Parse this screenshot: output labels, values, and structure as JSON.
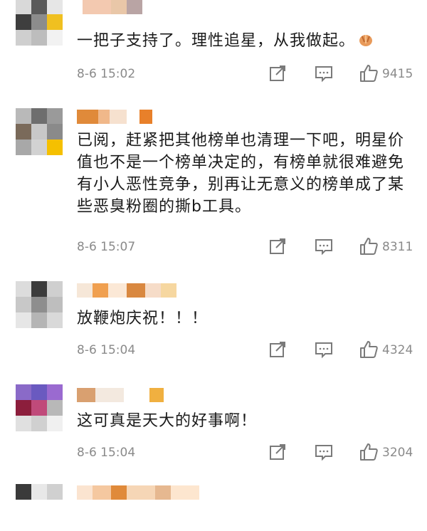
{
  "comments": [
    {
      "text": "一把子支持了。理性追星，从我做起。",
      "reaction_icon": "praying-hands-emoji",
      "time": "8-6 15:02",
      "likes": "9415",
      "avatar_colors": [
        "#d9d9d9",
        "#5a5a5a",
        "#e6e6e6",
        "#3e3e3e",
        "#8c8c8c",
        "#f0c020",
        "#cfcfcf",
        "#bdbdbd",
        "#f2f2f2"
      ],
      "name_colors": [
        "#ffffff",
        "#f3c9b0",
        "#e9c7a8",
        "#b9a4a4"
      ]
    },
    {
      "text": "已阅，赶紧把其他榜单也清理一下吧，明星价值也不是一个榜单决定的，有榜单就很难避免有小人恶性竞争，别再让无意义的榜单成了某些恶臭粉圈的撕b工具。",
      "time": "8-6 15:07",
      "likes": "8311",
      "avatar_colors": [
        "#b9b9b9",
        "#6e6e6e",
        "#9a9a9a",
        "#7a6a5a",
        "#c8c8c8",
        "#8a8a8a",
        "#a8a8a8",
        "#d2d2d2",
        "#f5c000"
      ],
      "name_colors": [
        "#e08a3a",
        "#f0b88a",
        "#f6e1cf",
        "#ffffff",
        "#e8802a"
      ]
    },
    {
      "text": "放鞭炮庆祝！！！",
      "time": "8-6 15:04",
      "likes": "4324",
      "avatar_colors": [
        "#dcdcdc",
        "#3c3c3c",
        "#cfcfcf",
        "#c8c8c8",
        "#8e8e8e",
        "#bebebe",
        "#e6e6e6",
        "#b5b5b5",
        "#d9d9d9"
      ],
      "name_colors": [
        "#f6e7d8",
        "#f0a050",
        "#fbe8d6",
        "#d98840",
        "#f6dcc8",
        "#f6d7a0"
      ]
    },
    {
      "text": "这可真是天大的好事啊！",
      "time": "8-6 15:04",
      "likes": "3204",
      "avatar_colors": [
        "#8a6ac8",
        "#6a5ac0",
        "#9a6ad0",
        "#8c1e3c",
        "#c04a7a",
        "#b8b8b8",
        "#e0e0e0",
        "#d0d0d0",
        "#f0f0f0"
      ],
      "name_colors": [
        "#d9a070",
        "#f3e9df",
        "#ffffff",
        "#f0b040"
      ]
    },
    {
      "avatar_colors": [
        "#3a3a3a",
        "#e8e8e8",
        "#d0d0d0"
      ],
      "name_colors": [
        "#fbe4d0",
        "#f5c8a0",
        "#e08a3a",
        "#f6d6b6",
        "#e6b890",
        "#fde6cf"
      ]
    }
  ]
}
